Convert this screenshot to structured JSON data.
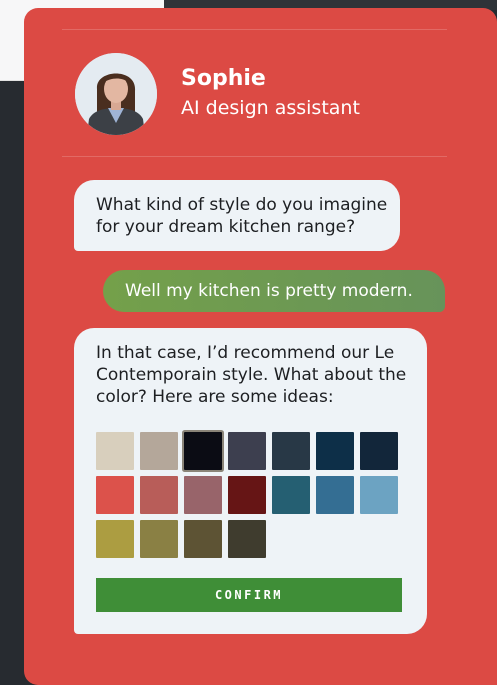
{
  "agent": {
    "name": "Sophie",
    "role": "AI design assistant"
  },
  "chat": {
    "messages": [
      {
        "sender": "assistant",
        "text": "What kind of style do you imagine for your dream kitchen range?"
      },
      {
        "sender": "user",
        "text": "Well my kitchen is pretty modern."
      },
      {
        "sender": "assistant",
        "text": "In that case, I’d recommend our Le Contemporain style. What about the color? Here are some ideas:"
      }
    ]
  },
  "palette": {
    "selected_index": 2,
    "colors": [
      "#d8cfbd",
      "#b4a79a",
      "#0b0c14",
      "#3d3f4f",
      "#283846",
      "#0d2f48",
      "#12263a",
      "#dc524b",
      "#b85d59",
      "#98646a",
      "#661515",
      "#255f72",
      "#346e93",
      "#6ca3c2",
      "#ac9d41",
      "#8a8044",
      "#5d5334",
      "#3f3c2e"
    ]
  },
  "confirm_label": "CONFIRM"
}
